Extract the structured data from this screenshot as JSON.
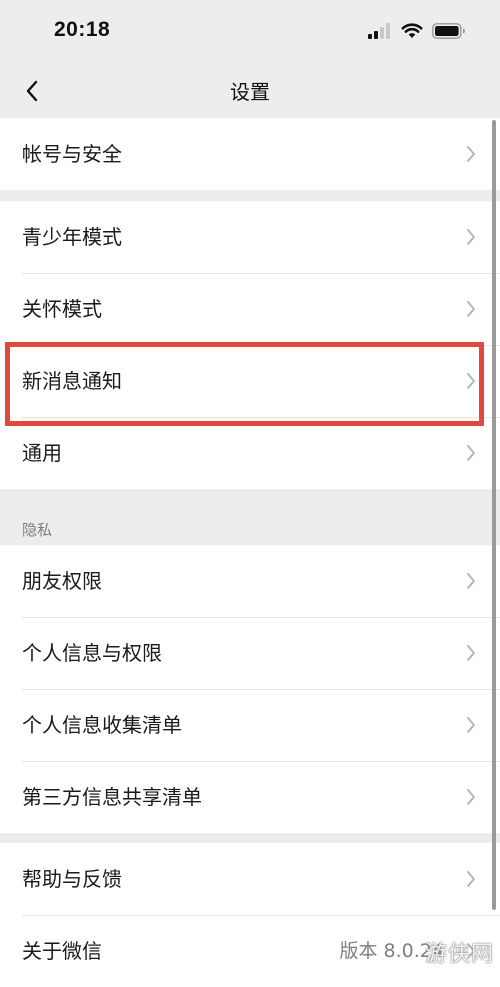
{
  "status_bar": {
    "time": "20:18",
    "icons": [
      "signal-icon",
      "wifi-icon",
      "battery-icon"
    ]
  },
  "nav": {
    "back_icon": "chevron-left-icon",
    "title": "设置"
  },
  "sections": {
    "account": [
      {
        "label": "帐号与安全"
      }
    ],
    "modes": [
      {
        "label": "青少年模式"
      },
      {
        "label": "关怀模式"
      },
      {
        "label": "新消息通知"
      },
      {
        "label": "通用"
      }
    ],
    "privacy_header": "隐私",
    "privacy": [
      {
        "label": "朋友权限"
      },
      {
        "label": "个人信息与权限"
      },
      {
        "label": "个人信息收集清单"
      },
      {
        "label": "第三方信息共享清单"
      }
    ],
    "about": [
      {
        "label": "帮助与反馈"
      },
      {
        "label": "关于微信",
        "value": "版本 8.0.24"
      }
    ]
  },
  "highlighted_item": "新消息通知",
  "colors": {
    "background": "#ededed",
    "row_background": "#ffffff",
    "highlight": "#e04a3a",
    "secondary_text": "#7f7f7f"
  },
  "watermark": "游侠网"
}
